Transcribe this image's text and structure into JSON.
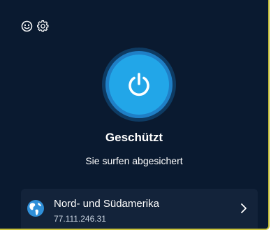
{
  "header": {
    "feedback_icon": "smiley-icon",
    "settings_icon": "gear-icon"
  },
  "power": {
    "icon": "power-icon",
    "accent": "#22a6e8"
  },
  "status": {
    "title": "Geschützt",
    "subtitle": "Sie surfen abgesichert"
  },
  "location": {
    "icon": "globe-icon",
    "name": "Nord- und Südamerika",
    "ip": "77.111.246.31",
    "chevron_icon": "chevron-right-icon"
  },
  "colors": {
    "background": "#0a1a30",
    "card": "#13233a",
    "accent": "#22a6e8",
    "border": "#c9c23a"
  }
}
